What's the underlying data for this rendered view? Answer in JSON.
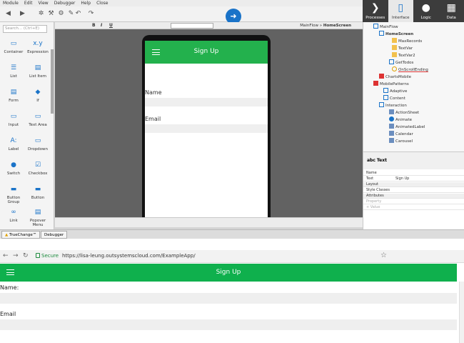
{
  "menu": [
    "Module",
    "Edit",
    "View",
    "Debugger",
    "Help",
    "Close"
  ],
  "tabs": [
    {
      "label": "Processes",
      "icon": "processes-icon"
    },
    {
      "label": "Interface",
      "icon": "interface-icon",
      "active": true
    },
    {
      "label": "Logic",
      "icon": "logic-icon"
    },
    {
      "label": "Data",
      "icon": "data-icon"
    }
  ],
  "toolbox": {
    "search_placeholder": "Search... (Ctrl+E)",
    "widgets": [
      "Container",
      "Expression",
      "List",
      "List Item",
      "Form",
      "If",
      "Input",
      "Text Area",
      "Label",
      "Dropdown",
      "Switch",
      "Checkbox",
      "Button Group",
      "Button",
      "Link",
      "Popover Menu"
    ]
  },
  "format_bar": {
    "bold": "B",
    "italic": "I",
    "underline": "U"
  },
  "breadcrumb": {
    "flow": "MainFlow",
    "separator": " » ",
    "screen": "HomeScreen"
  },
  "phone": {
    "title": "Sign Up",
    "name_label": "Name",
    "email_label": "Email"
  },
  "bottom_tabs": [
    "TrueChange™",
    "Debugger"
  ],
  "tree": [
    "MainFlow",
    "HomeScreen",
    "MaxRecords",
    "TextVar",
    "TextVar2",
    "GetTodos",
    "OnScrollEnding",
    "ChartsMobile",
    "MobilePatterns",
    "Adaptive",
    "Content",
    "Interaction",
    "ActionSheet",
    "Animate",
    "AnimatedLabel",
    "Calendar",
    "Carousel"
  ],
  "properties": {
    "widget_type": "Text",
    "rows": [
      {
        "name": "Name",
        "value": ""
      },
      {
        "name": "Text",
        "value": "Sign Up"
      },
      {
        "name": "Layout",
        "value": "",
        "section": true
      },
      {
        "name": "Style Classes",
        "value": ""
      },
      {
        "name": "Attributes",
        "value": "",
        "section": true
      },
      {
        "name": "Property",
        "value": ""
      },
      {
        "name": "+ Value",
        "value": ""
      }
    ]
  },
  "browser": {
    "secure_label": "Secure",
    "url": "https://lisa-leung.outsystemscloud.com/ExampleApp/"
  },
  "app": {
    "title": "Sign Up",
    "name_label": "Name:",
    "email_label": "Email"
  },
  "colors": {
    "app_header": "#0fb04d",
    "phone_header": "#23b14d",
    "secure": "#1b8a3c"
  }
}
